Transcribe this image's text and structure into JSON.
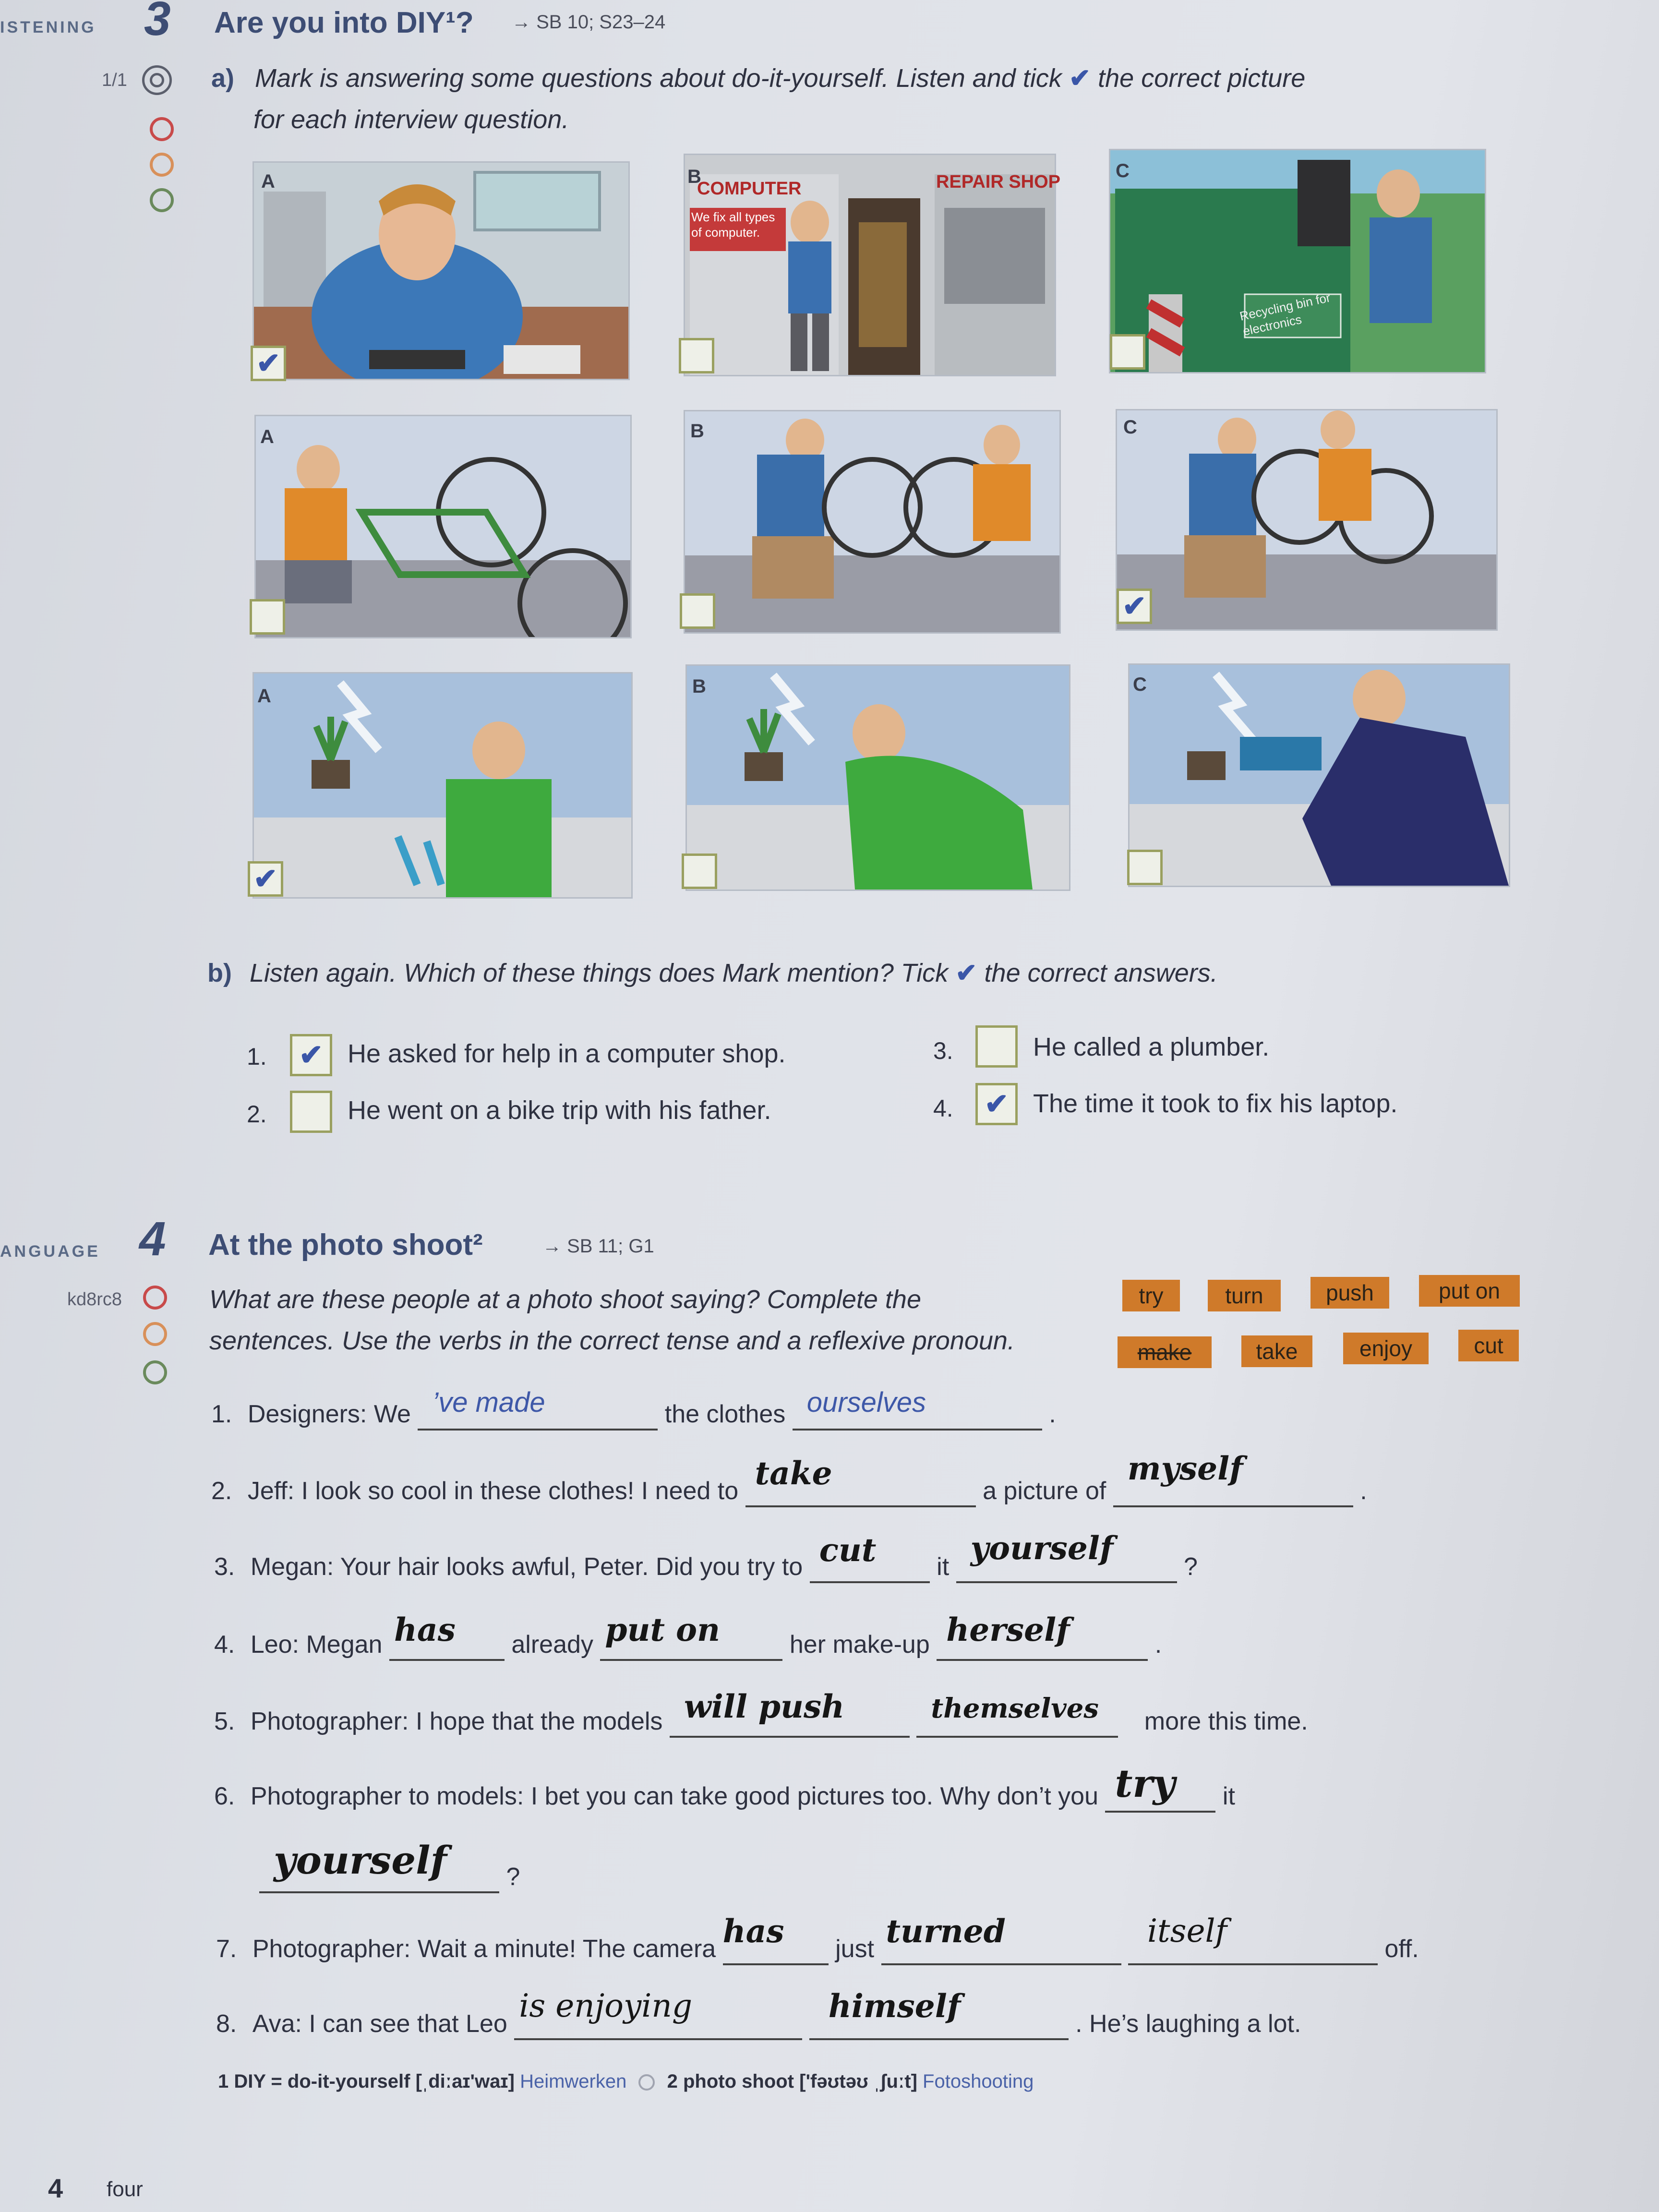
{
  "ex3": {
    "side_label": "ISTENING",
    "number": "3",
    "title": "Are you into DIY¹?",
    "ref": "→ SB 10; S23–24",
    "track": "1/1",
    "part_a_label": "a)",
    "part_a_line1": "Mark is answering some questions about do-it-yourself. Listen and tick",
    "part_a_line1b": "the correct picture",
    "part_a_line2": "for each interview question.",
    "tick": "✔",
    "rows": [
      {
        "items": [
          {
            "letter": "A",
            "checked": true,
            "desc": "man fixing device at kitchen table"
          },
          {
            "letter": "B",
            "checked": false,
            "sign1": "COMPUTER",
            "sign_sub": "We fix all types of computer.",
            "sign2": "REPAIR SHOP"
          },
          {
            "letter": "C",
            "checked": false,
            "sign": "Recycling bin for electronics"
          }
        ]
      },
      {
        "items": [
          {
            "letter": "A",
            "checked": false
          },
          {
            "letter": "B",
            "checked": false
          },
          {
            "letter": "C",
            "checked": true
          }
        ]
      },
      {
        "items": [
          {
            "letter": "A",
            "checked": true
          },
          {
            "letter": "B",
            "checked": false
          },
          {
            "letter": "C",
            "checked": false
          }
        ]
      }
    ],
    "part_b_label": "b)",
    "part_b_instr": "Listen again. Which of these things does Mark mention? Tick",
    "part_b_instr2": "the correct answers.",
    "answers": [
      {
        "num": "1.",
        "text": "He asked for help in a computer shop.",
        "checked": true
      },
      {
        "num": "2.",
        "text": "He went on a bike trip with his father.",
        "checked": false
      },
      {
        "num": "3.",
        "text": "He called a plumber.",
        "checked": false
      },
      {
        "num": "4.",
        "text": "The time it took to fix his laptop.",
        "checked": true
      }
    ]
  },
  "ex4": {
    "side_label": "ANGUAGE",
    "number": "4",
    "title": "At the photo shoot²",
    "ref": "→ SB 11; G1",
    "code": "kd8rc8",
    "instr1": "What are these people at a photo shoot saying? Complete the",
    "instr2": "sentences. Use the verbs in the correct tense and a reflexive pronoun.",
    "verbs_row1": [
      "try",
      "turn",
      "push",
      "put on"
    ],
    "verbs_row2": [
      "make",
      "take",
      "enjoy",
      "cut"
    ],
    "sentences": {
      "s1": {
        "num": "1.",
        "a": "Designers: We",
        "ans1": "’ve made",
        "b": "the clothes",
        "ans2": "ourselves",
        "end": "."
      },
      "s2": {
        "num": "2.",
        "a": "Jeff: I look so cool in these clothes! I need to",
        "ans1": "take",
        "b": "a picture of",
        "ans2": "myself",
        "end": "."
      },
      "s3": {
        "num": "3.",
        "a": "Megan: Your hair looks awful, Peter. Did you try to",
        "ans1": "cut",
        "b": "it",
        "ans2": "yourself",
        "end": "?"
      },
      "s4": {
        "num": "4.",
        "a": "Leo: Megan",
        "ans1": "has",
        "b": "already",
        "ans2": "put on",
        "c": "her make-up",
        "ans3": "herself",
        "end": "."
      },
      "s5": {
        "num": "5.",
        "a": "Photographer: I hope that the models",
        "ans1": "will push",
        "ans2": "themselves",
        "end": "more this time."
      },
      "s6": {
        "num": "6.",
        "a": "Photographer to models: I bet you can take good pictures too. Why don’t you",
        "ans1": "try",
        "b": "it",
        "ans2": "yourself",
        "end": "?"
      },
      "s7": {
        "num": "7.",
        "a": "Photographer: Wait a minute! The camera",
        "ans1": "has",
        "b": "just",
        "ans2": "turned",
        "ans3": "itself",
        "end": "off."
      },
      "s8": {
        "num": "8.",
        "a": "Ava: I can see that Leo",
        "ans1": "is enjoying",
        "ans2": "himself",
        "end": ". He’s laughing a lot."
      }
    }
  },
  "footnote": {
    "n1": "1 DIY = do-it-yourself [ˌdiːaɪ'waɪ]",
    "g1": "Heimwerken",
    "n2": "2 photo shoot ['fəʊtəʊ ˌʃuːt]",
    "g2": "Fotoshooting"
  },
  "page": {
    "number": "4",
    "word": "four"
  }
}
